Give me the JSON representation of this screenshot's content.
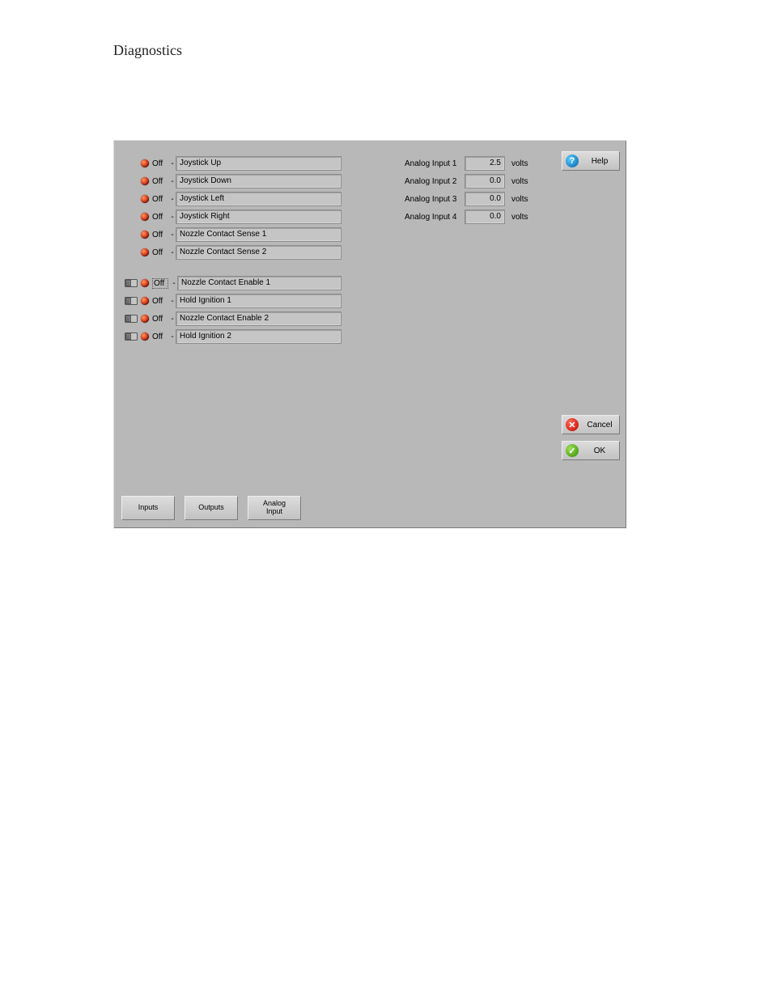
{
  "title": "Diagnostics",
  "io": {
    "group1": [
      {
        "state": "Off",
        "label": "Joystick Up",
        "boxed": false
      },
      {
        "state": "Off",
        "label": "Joystick Down",
        "boxed": false
      },
      {
        "state": "Off",
        "label": "Joystick Left",
        "boxed": false
      },
      {
        "state": "Off",
        "label": "Joystick Right",
        "boxed": false
      },
      {
        "state": "Off",
        "label": "Nozzle Contact Sense 1",
        "boxed": false
      },
      {
        "state": "Off",
        "label": "Nozzle Contact Sense 2",
        "boxed": false
      }
    ],
    "group2": [
      {
        "state": "Off",
        "label": "Nozzle Contact Enable 1",
        "boxed": true
      },
      {
        "state": "Off",
        "label": "Hold Ignition 1",
        "boxed": false
      },
      {
        "state": "Off",
        "label": "Nozzle Contact Enable 2",
        "boxed": false
      },
      {
        "state": "Off",
        "label": "Hold Ignition 2",
        "boxed": false
      }
    ]
  },
  "analog": [
    {
      "label": "Analog Input 1",
      "value": "2.5",
      "unit": "volts"
    },
    {
      "label": "Analog Input 2",
      "value": "0.0",
      "unit": "volts"
    },
    {
      "label": "Analog Input 3",
      "value": "0.0",
      "unit": "volts"
    },
    {
      "label": "Analog Input 4",
      "value": "0.0",
      "unit": "volts"
    }
  ],
  "buttons": {
    "help": "Help",
    "cancel": "Cancel",
    "ok": "OK",
    "inputs": "Inputs",
    "outputs": "Outputs",
    "analog_input": "Analog\nInput"
  },
  "glyphs": {
    "help": "?",
    "cancel": "✕",
    "ok": "✓",
    "dash": "-"
  }
}
